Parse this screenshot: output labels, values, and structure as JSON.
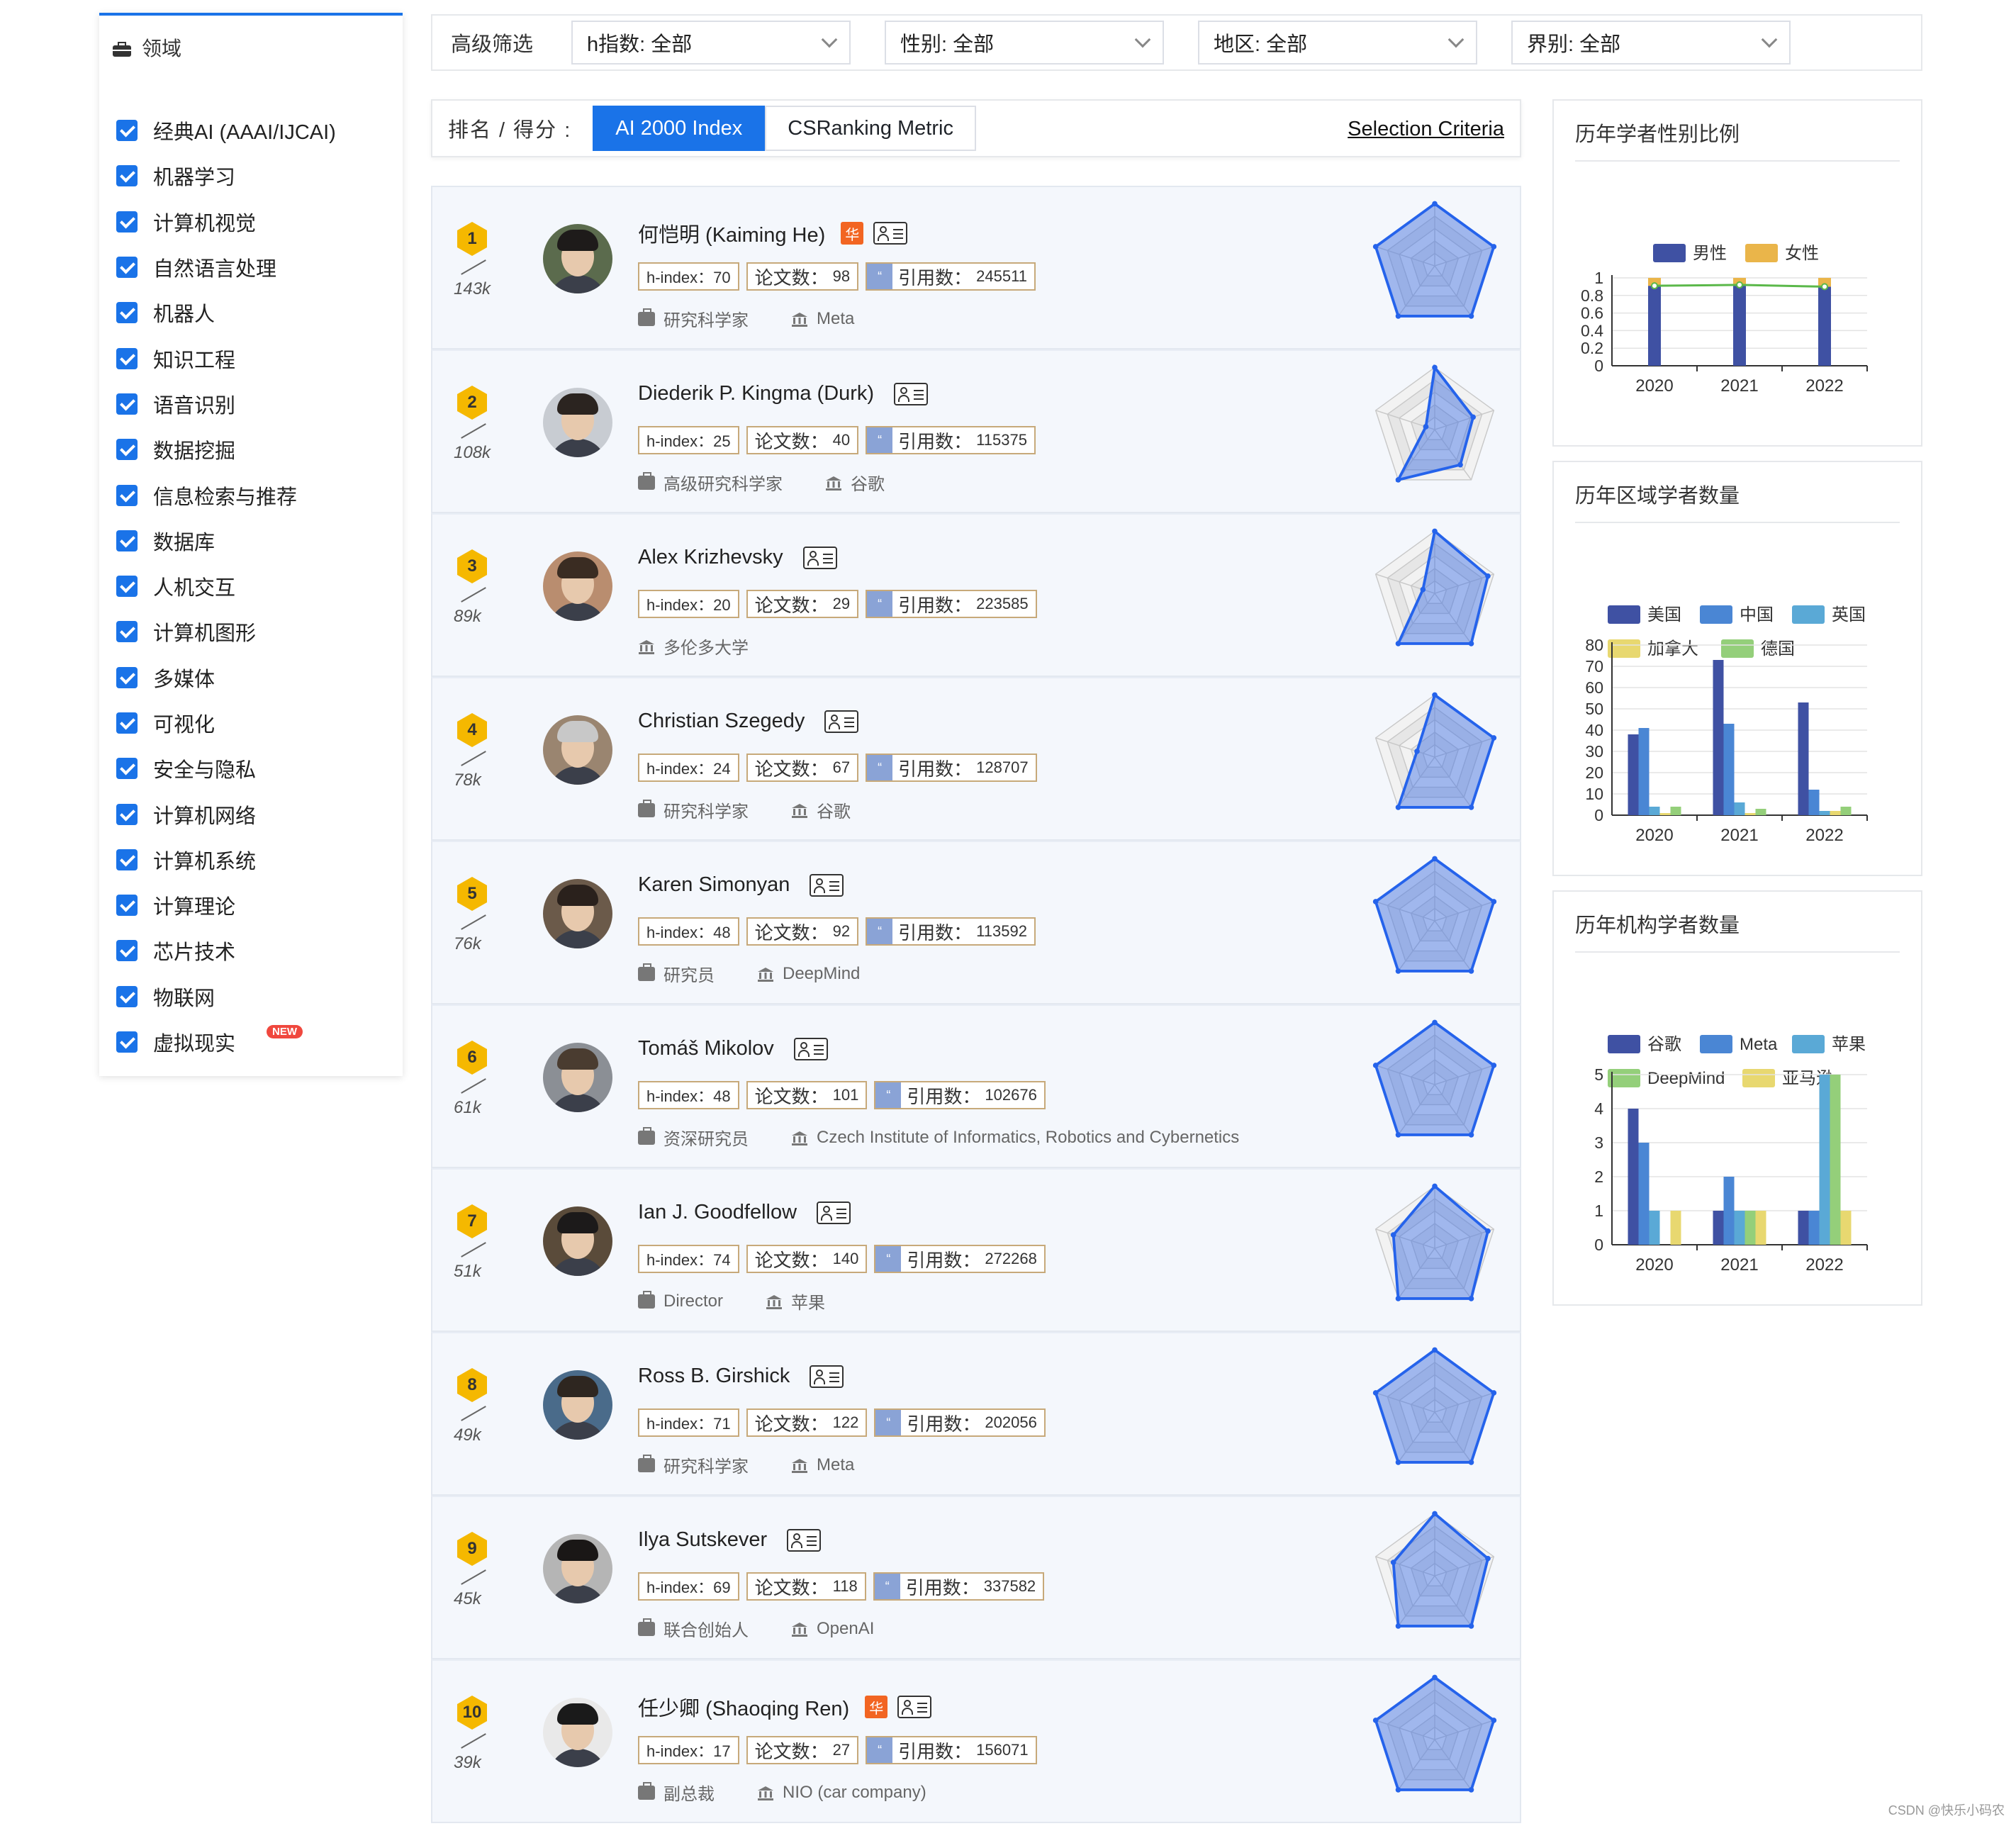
{
  "sidebar": {
    "title": "领域",
    "items": [
      {
        "label": "经典AI (AAAI/IJCAI)"
      },
      {
        "label": "机器学习"
      },
      {
        "label": "计算机视觉"
      },
      {
        "label": "自然语言处理"
      },
      {
        "label": "机器人"
      },
      {
        "label": "知识工程"
      },
      {
        "label": "语音识别"
      },
      {
        "label": "数据挖掘"
      },
      {
        "label": "信息检索与推荐"
      },
      {
        "label": "数据库"
      },
      {
        "label": "人机交互"
      },
      {
        "label": "计算机图形"
      },
      {
        "label": "多媒体"
      },
      {
        "label": "可视化"
      },
      {
        "label": "安全与隐私"
      },
      {
        "label": "计算机网络"
      },
      {
        "label": "计算机系统"
      },
      {
        "label": "计算理论"
      },
      {
        "label": "芯片技术"
      },
      {
        "label": "物联网"
      },
      {
        "label": "虚拟现实",
        "badge": "NEW"
      }
    ]
  },
  "filters": {
    "label": "高级筛选",
    "selects": [
      {
        "value": "h指数: 全部"
      },
      {
        "value": "性别: 全部"
      },
      {
        "value": "地区: 全部"
      },
      {
        "value": "界别: 全部"
      }
    ]
  },
  "rank": {
    "label": "排名 / 得分 :",
    "tabs": [
      {
        "label": "AI 2000 Index",
        "active": true
      },
      {
        "label": "CSRanking Metric",
        "active": false
      }
    ],
    "criteria": "Selection Criteria"
  },
  "scholars": [
    {
      "rank": "1",
      "score": "143k",
      "name": "何恺明 (Kaiming He)",
      "hua": true,
      "hindex": "h-index：70",
      "papers_label": "论文数：",
      "papers": "98",
      "cite_label": "引用数：",
      "cites": "245511",
      "title": "研究科学家",
      "org": "Meta",
      "radar": [
        1.0,
        1.0,
        1.0,
        1.0,
        1.0
      ]
    },
    {
      "rank": "2",
      "score": "108k",
      "name": "Diederik P. Kingma (Durk)",
      "hua": false,
      "hindex": "h-index：25",
      "papers_label": "论文数：",
      "papers": "40",
      "cite_label": "引用数：",
      "cites": "115375",
      "title": "高级研究科学家",
      "org": "谷歌",
      "radar": [
        1.0,
        0.65,
        0.7,
        1.0,
        0.15
      ]
    },
    {
      "rank": "3",
      "score": "89k",
      "name": "Alex Krizhevsky",
      "hua": false,
      "hindex": "h-index：20",
      "papers_label": "论文数：",
      "papers": "29",
      "cite_label": "引用数：",
      "cites": "223585",
      "title": "",
      "org": "多伦多大学",
      "radar": [
        1.0,
        0.9,
        1.0,
        1.0,
        0.2
      ]
    },
    {
      "rank": "4",
      "score": "78k",
      "name": "Christian Szegedy",
      "hua": false,
      "hindex": "h-index：24",
      "papers_label": "论文数：",
      "papers": "67",
      "cite_label": "引用数：",
      "cites": "128707",
      "title": "研究科学家",
      "org": "谷歌",
      "radar": [
        1.0,
        1.0,
        1.0,
        1.0,
        0.3
      ]
    },
    {
      "rank": "5",
      "score": "76k",
      "name": "Karen Simonyan",
      "hua": false,
      "hindex": "h-index：48",
      "papers_label": "论文数：",
      "papers": "92",
      "cite_label": "引用数：",
      "cites": "113592",
      "title": "研究员",
      "org": "DeepMind",
      "radar": [
        1.0,
        1.0,
        1.0,
        1.0,
        1.0
      ]
    },
    {
      "rank": "6",
      "score": "61k",
      "name": "Tomáš Mikolov",
      "hua": false,
      "hindex": "h-index：48",
      "papers_label": "论文数：",
      "papers": "101",
      "cite_label": "引用数：",
      "cites": "102676",
      "title": "资深研究员",
      "org": "Czech Institute of Informatics, Robotics and Cybernetics",
      "radar": [
        1.0,
        1.0,
        1.0,
        1.0,
        1.0
      ]
    },
    {
      "rank": "7",
      "score": "51k",
      "name": "Ian J. Goodfellow",
      "hua": false,
      "hindex": "h-index：74",
      "papers_label": "论文数：",
      "papers": "140",
      "cite_label": "引用数：",
      "cites": "272268",
      "title": "Director",
      "org": "苹果",
      "radar": [
        1.0,
        0.9,
        1.0,
        1.0,
        0.7
      ]
    },
    {
      "rank": "8",
      "score": "49k",
      "name": "Ross B. Girshick",
      "hua": false,
      "hindex": "h-index：71",
      "papers_label": "论文数：",
      "papers": "122",
      "cite_label": "引用数：",
      "cites": "202056",
      "title": "研究科学家",
      "org": "Meta",
      "radar": [
        1.0,
        1.0,
        1.0,
        1.0,
        1.0
      ]
    },
    {
      "rank": "9",
      "score": "45k",
      "name": "Ilya Sutskever",
      "hua": false,
      "hindex": "h-index：69",
      "papers_label": "论文数：",
      "papers": "118",
      "cite_label": "引用数：",
      "cites": "337582",
      "title": "联合创始人",
      "org": "OpenAI",
      "radar": [
        1.0,
        0.9,
        1.0,
        1.0,
        0.7
      ]
    },
    {
      "rank": "10",
      "score": "39k",
      "name": "任少卿 (Shaoqing Ren)",
      "hua": true,
      "hindex": "h-index：17",
      "papers_label": "论文数：",
      "papers": "27",
      "cite_label": "引用数：",
      "cites": "156071",
      "title": "副总裁",
      "org": "NIO (car company)",
      "radar": [
        1.0,
        1.0,
        1.0,
        1.0,
        1.0
      ]
    }
  ],
  "icons": {
    "hua": "华",
    "cite": "“"
  },
  "colors": {
    "accent": "#1a73e8",
    "male": "#3f51a3",
    "female": "#eab54a",
    "us": "#3f51a3",
    "cn": "#4a86d4",
    "uk": "#5aa9d6",
    "ca": "#e8d870",
    "de": "#94cf7a"
  },
  "chart_data": [
    {
      "type": "bar",
      "title": "历年学者性别比例",
      "categories": [
        "2020",
        "2021",
        "2022"
      ],
      "series": [
        {
          "name": "男性",
          "values": [
            0.91,
            0.92,
            0.9
          ]
        },
        {
          "name": "女性",
          "values": [
            0.09,
            0.08,
            0.1
          ]
        }
      ],
      "line": [
        0.91,
        0.92,
        0.9
      ],
      "stacked": true,
      "ylim": [
        0,
        1
      ],
      "yticks": [
        "0",
        "0.2",
        "0.4",
        "0.6",
        "0.8",
        "1"
      ],
      "legend": "top"
    },
    {
      "type": "bar",
      "title": "历年区域学者数量",
      "categories": [
        "2020",
        "2021",
        "2022"
      ],
      "series": [
        {
          "name": "美国",
          "values": [
            38,
            73,
            53
          ]
        },
        {
          "name": "中国",
          "values": [
            41,
            43,
            12
          ]
        },
        {
          "name": "英国",
          "values": [
            4,
            6,
            2
          ]
        },
        {
          "name": "加拿大",
          "values": [
            1,
            1,
            2
          ]
        },
        {
          "name": "德国",
          "values": [
            4,
            3,
            4
          ]
        }
      ],
      "ylim": [
        0,
        80
      ],
      "yticks": [
        "0",
        "10",
        "20",
        "30",
        "40",
        "50",
        "60",
        "70",
        "80"
      ],
      "legend": "top"
    },
    {
      "type": "bar",
      "title": "历年机构学者数量",
      "categories": [
        "2020",
        "2021",
        "2022"
      ],
      "series": [
        {
          "name": "谷歌",
          "values": [
            4,
            1,
            1
          ]
        },
        {
          "name": "Meta",
          "values": [
            3,
            2,
            1
          ]
        },
        {
          "name": "苹果",
          "values": [
            1,
            1,
            5
          ]
        },
        {
          "name": "DeepMind",
          "values": [
            0,
            1,
            5
          ]
        },
        {
          "name": "亚马逊",
          "values": [
            1,
            1,
            1
          ]
        }
      ],
      "ylim": [
        0,
        5
      ],
      "yticks": [
        "0",
        "1",
        "2",
        "3",
        "4",
        "5"
      ],
      "legend": "top"
    }
  ],
  "watermark": "CSDN @快乐小码农"
}
